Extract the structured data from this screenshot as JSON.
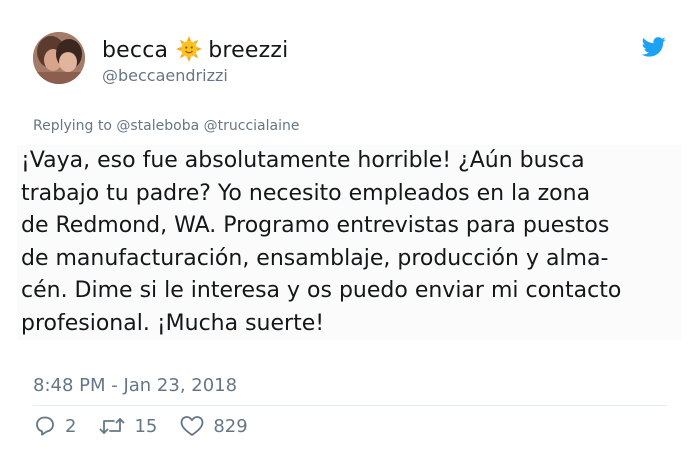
{
  "user": {
    "name_first": "becca",
    "name_emoji": "sun-with-face-icon",
    "name_last": "breezzi",
    "handle": "@beccaendrizzi"
  },
  "reply": {
    "prefix": "Replying to",
    "mentions": "@staleboba @truccialaine"
  },
  "tweet": {
    "text": "¡Vaya, eso fue absolutamente horrible! ¿Aún busca\ntrabajo tu padre? Yo necesito empleados en la zona\nde Redmond, WA. Programo entrevistas para puestos\nde manufacturación, ensamblaje, producción y alma-\ncén. Dime si le interesa y os puedo enviar mi contacto\nprofesional. ¡Mucha suerte!",
    "timestamp": "8:48 PM - Jan 23, 2018"
  },
  "actions": {
    "replies": "2",
    "retweets": "15",
    "likes": "829"
  },
  "colors": {
    "twitter_blue": "#1da1f2",
    "secondary_text": "#657786",
    "primary_text": "#14171a"
  }
}
